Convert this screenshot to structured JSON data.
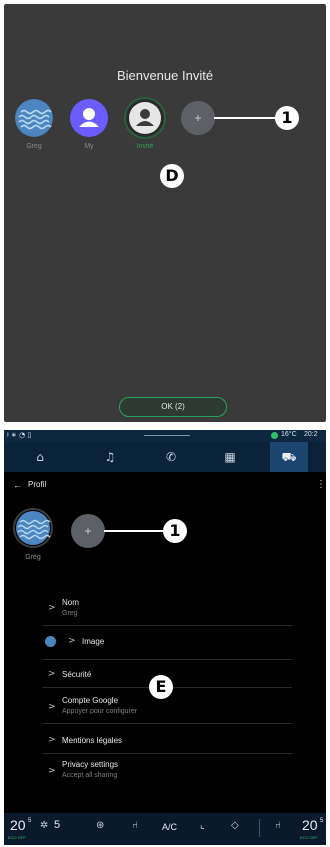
{
  "screen_d": {
    "welcome": "Bienvenue Invité",
    "profiles": [
      {
        "label": "Greg"
      },
      {
        "label": "My"
      },
      {
        "label": "Invité"
      }
    ],
    "add_symbol": "+",
    "callout_1": "1",
    "callout_d": "D",
    "ok_button": "OK (2)",
    "colors": {
      "active_green": "#2fa05c",
      "my_purple": "#6b5cff"
    }
  },
  "screen_e": {
    "status": {
      "temp": "16°C",
      "time": "20:2"
    },
    "nav_icons": [
      "home-icon",
      "music-icon",
      "phone-icon",
      "apps-icon",
      "car-icon"
    ],
    "header": {
      "back": "←",
      "title": "Profil",
      "menu": "⋮"
    },
    "profile": {
      "name": "Greg"
    },
    "add_symbol": "+",
    "callout_1": "1",
    "callout_e": "E",
    "settings": [
      {
        "title": "Nom",
        "subtitle": "Greg"
      },
      {
        "title": "Image",
        "subtitle": ""
      },
      {
        "title": "Sécurité",
        "subtitle": ""
      },
      {
        "title": "Compte Google",
        "subtitle": "Appuyer pour configurer"
      },
      {
        "title": "Mentions légales",
        "subtitle": ""
      },
      {
        "title": "Privacy settings",
        "subtitle": "Accept all sharing"
      }
    ],
    "bottom": {
      "temp_left": "20",
      "temp_left_frac": "5",
      "eco_left": "ECO OFF",
      "fan": "5",
      "ac": "A/C",
      "temp_right": "20",
      "temp_right_frac": "5",
      "eco_right": "ECO OFF"
    }
  }
}
